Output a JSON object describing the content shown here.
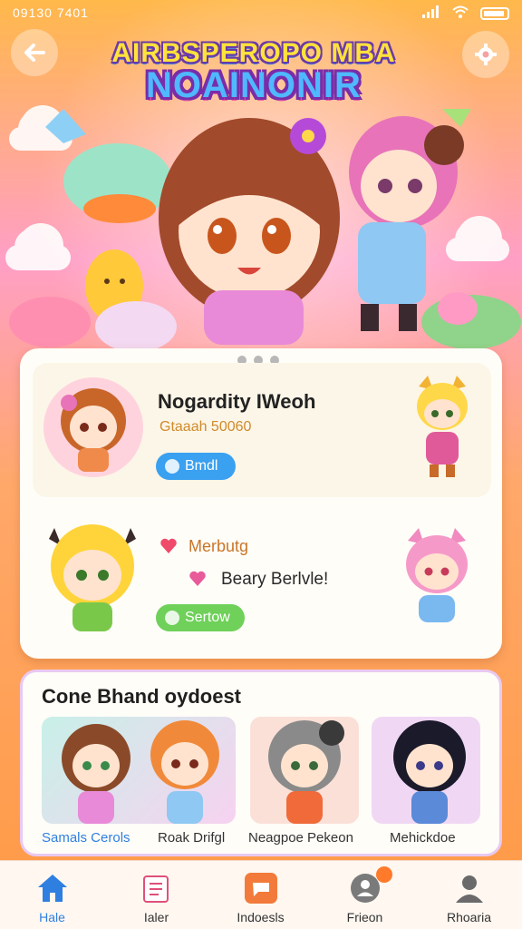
{
  "status_bar": {
    "time": "09130 7401"
  },
  "header": {
    "back_icon": "arrow-left-icon",
    "settings_icon": "gear-icon",
    "logo_line1": "AIRBSPEROPO MBA",
    "logo_line2": "NOAINONIR"
  },
  "featured": {
    "title": "Nogardity IWeoh",
    "subtitle": "Gtaaah 50060",
    "action_label": "Bmdl"
  },
  "match": {
    "label": "Merbutg",
    "value": "Beary Berlvle!",
    "action_label": "Sertow"
  },
  "collection": {
    "title": "Cone Bhand oydoest",
    "tiles": [
      {
        "name": "Samals Cerols"
      },
      {
        "name": "Roak Drifgl"
      },
      {
        "name": "Neagpoe Pekeon"
      },
      {
        "name": "Mehickdoe"
      }
    ]
  },
  "nav": {
    "items": [
      {
        "label": "Hale",
        "icon": "home-icon"
      },
      {
        "label": "Ialer",
        "icon": "book-icon"
      },
      {
        "label": "Indoesls",
        "icon": "chat-icon"
      },
      {
        "label": "Frieon",
        "icon": "friend-icon",
        "badge": ""
      },
      {
        "label": "Rhoaria",
        "icon": "profile-icon"
      }
    ]
  },
  "colors": {
    "accent_blue": "#3aa0f0",
    "accent_green": "#6fd05a",
    "accent_orange": "#ff9a45"
  }
}
